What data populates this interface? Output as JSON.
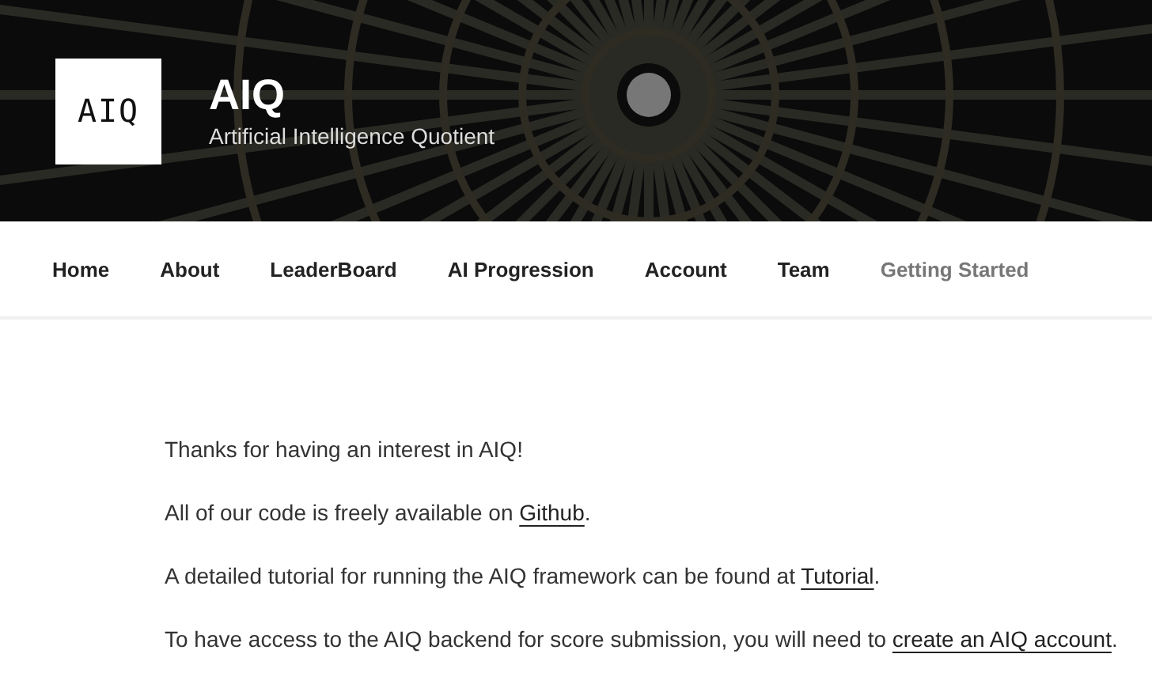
{
  "header": {
    "logo": "AIQ",
    "title": "AIQ",
    "tagline": "Artificial Intelligence Quotient"
  },
  "nav": [
    {
      "label": "Home",
      "selected": false
    },
    {
      "label": "About",
      "selected": false
    },
    {
      "label": "LeaderBoard",
      "selected": false
    },
    {
      "label": "AI Progression",
      "selected": false
    },
    {
      "label": "Account",
      "selected": false
    },
    {
      "label": "Team",
      "selected": false
    },
    {
      "label": "Getting Started",
      "selected": true
    }
  ],
  "paragraphs": [
    {
      "text": "Thanks for having an interest in AIQ!"
    },
    {
      "text": "All of our code is freely available on ",
      "link": "Github",
      "after": "."
    },
    {
      "text": "A detailed tutorial for running the AIQ framework can be found at ",
      "link": "Tutorial",
      "after": "."
    },
    {
      "text": "To have access to the AIQ backend for score submission, you will need to ",
      "link": "create an AIQ account",
      "after": "."
    }
  ]
}
